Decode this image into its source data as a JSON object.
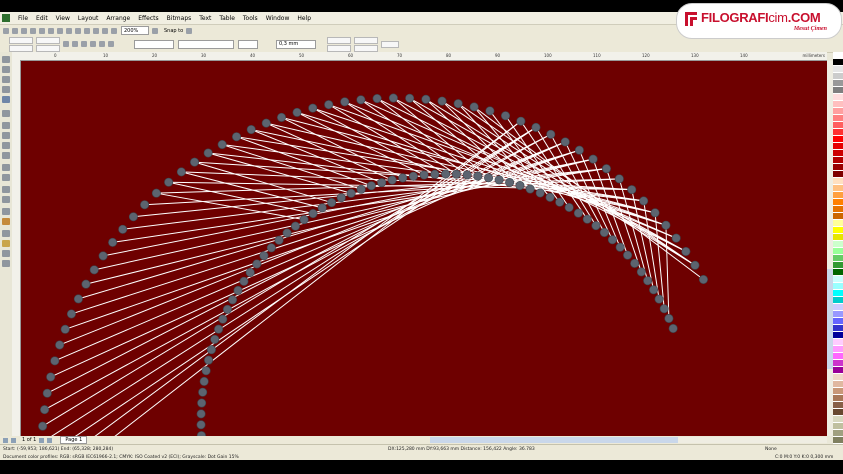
{
  "menu": {
    "items": [
      "File",
      "Edit",
      "View",
      "Layout",
      "Arrange",
      "Effects",
      "Bitmaps",
      "Text",
      "Table",
      "Tools",
      "Window",
      "Help"
    ]
  },
  "toolbar": {
    "zoom_value": "200%",
    "snap_label": "Snap to",
    "outline_width": "0,3 mm"
  },
  "ruler": {
    "unit": "millimeters",
    "ticks": [
      "0",
      "10",
      "20",
      "30",
      "40",
      "50",
      "60",
      "70",
      "80",
      "90",
      "100",
      "110",
      "120",
      "130",
      "140"
    ]
  },
  "brand": {
    "name_a": "FILOGRAFI",
    "name_b": "cim",
    "name_c": ".COM",
    "author": "Mesut Çimen"
  },
  "page_nav": {
    "counter": "1 of 1",
    "tab": "Page 1"
  },
  "status": {
    "start_end": "Start: (-59,953; 186,621)  End: (65,328; 280,284)",
    "deltas": "DX:125,280 mm DY:93,663 mm Distance: 156,422 Angle: 36.783",
    "profile": "Document color profiles: RGB: sRGB IEC61966-2.1; CMYK: ISO Coated v2 (ECI); Grayscale: Dot Gain 15%",
    "fill": "None",
    "outline": "C:0 M:0 Y:0 K:0  0,300 mm"
  },
  "colors": {
    "canvas": "#6e0000",
    "pin": "#5c6470",
    "thread": "#ffffff",
    "brand": "#c8102e"
  }
}
